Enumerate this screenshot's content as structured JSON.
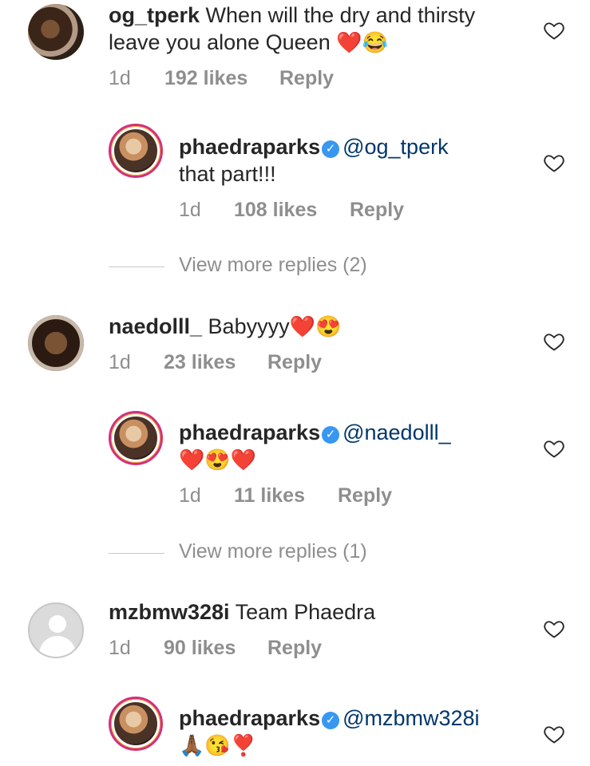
{
  "comments": [
    {
      "username": "og_tperk",
      "text_line1": "When will the dry and thirsty",
      "text_line2": "leave you alone Queen",
      "emoji": "❤️😂",
      "time": "1d",
      "likes": "192 likes",
      "reply": "Reply"
    },
    {
      "username": "phaedraparks",
      "mention": "@og_tperk",
      "text": "that part!!!",
      "time": "1d",
      "likes": "108 likes",
      "reply": "Reply"
    },
    {
      "view_more": "View more replies (2)"
    },
    {
      "username": "naedolll_",
      "text": "Babyyyy",
      "emoji": "❤️😍",
      "time": "1d",
      "likes": "23 likes",
      "reply": "Reply"
    },
    {
      "username": "phaedraparks",
      "mention": "@naedolll_",
      "emoji": "❤️😍❤️",
      "time": "1d",
      "likes": "11 likes",
      "reply": "Reply"
    },
    {
      "view_more": "View more replies (1)"
    },
    {
      "username": "mzbmw328i",
      "text": "Team Phaedra",
      "time": "1d",
      "likes": "90 likes",
      "reply": "Reply"
    },
    {
      "username": "phaedraparks",
      "mention": "@mzbmw328i",
      "emoji": "🙏🏾😘❣️"
    }
  ],
  "icons": {
    "heart": "heart-outline-icon",
    "verified": "verified-badge-icon"
  },
  "colors": {
    "text": "#262626",
    "meta": "#8e8e8e",
    "mention": "#00376b",
    "verified": "#3897f0"
  }
}
